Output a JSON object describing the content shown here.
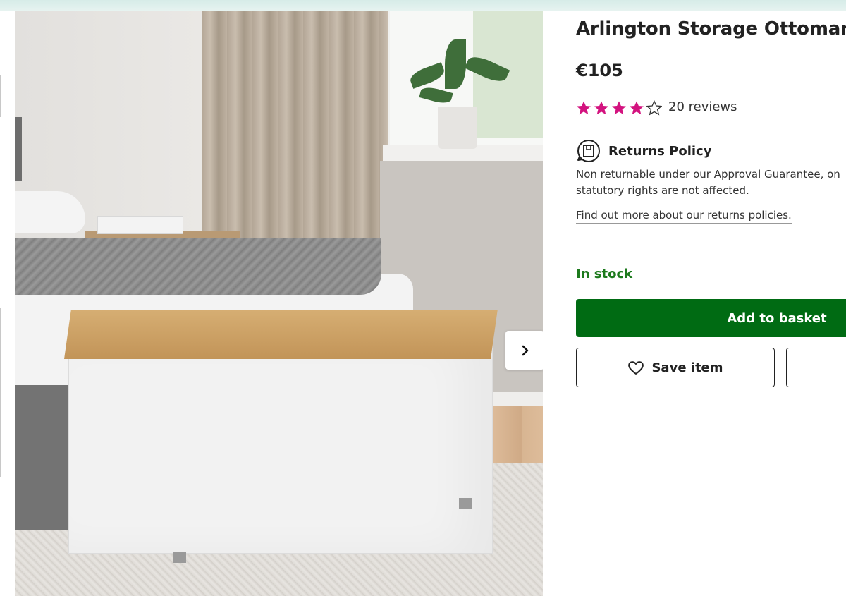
{
  "product": {
    "title": "Arlington Storage Ottoman",
    "price": "€105",
    "rating": {
      "value": 4,
      "max": 5
    },
    "reviews_label": "20 reviews"
  },
  "returns": {
    "title": "Returns Policy",
    "line1": "Non returnable under our Approval Guarantee, on",
    "line2": "statutory rights are not affected.",
    "link": "Find out more about our returns policies."
  },
  "stock_status": "In stock",
  "actions": {
    "add_to_basket": "Add to basket",
    "save_item": "Save item"
  },
  "colors": {
    "star": "#d3137f",
    "primary_green": "#006b13",
    "stock_green": "#1d7a1d"
  },
  "icons": {
    "next": "chevron-right-icon",
    "returns": "returns-box-icon",
    "save": "heart-outline-icon",
    "star_filled": "star-filled-icon",
    "star_empty": "star-outline-icon"
  }
}
